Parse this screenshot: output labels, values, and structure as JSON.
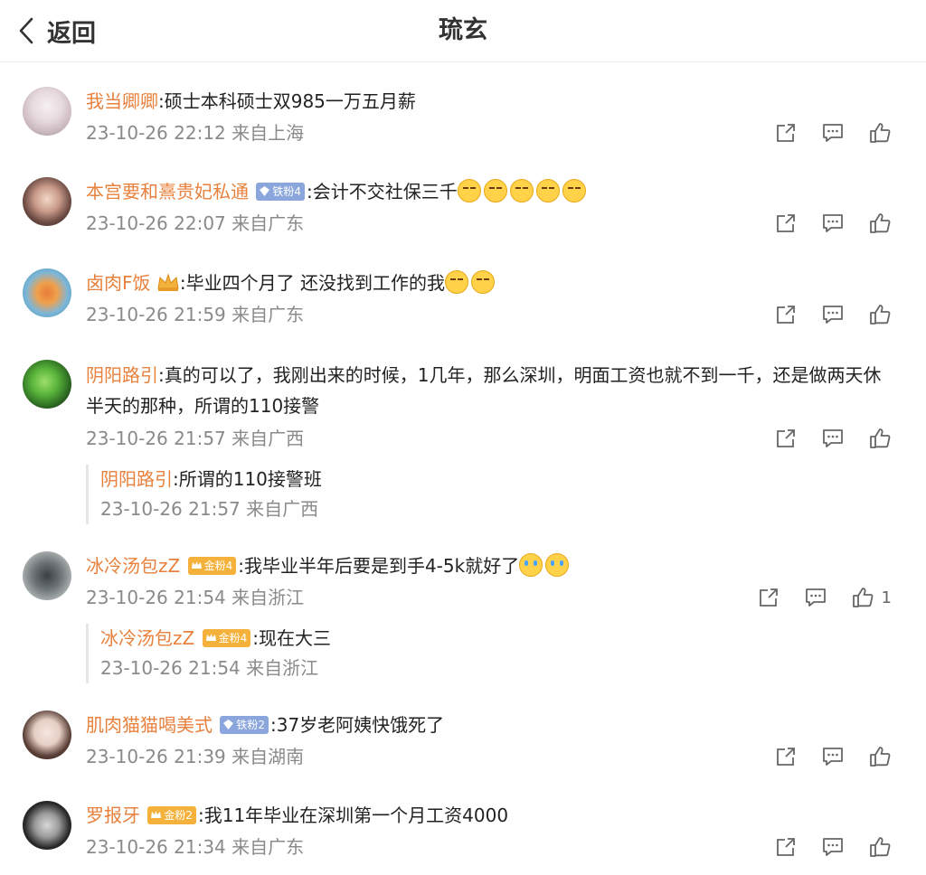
{
  "header": {
    "back_label": "返回",
    "title": "琉玄"
  },
  "comments": [
    {
      "username": "我当卿卿",
      "text": ":硕士本科硕士双985一万五月薪",
      "meta": "23-10-26 22:12 来自上海"
    },
    {
      "username": "本宫要和熹贵妃私通",
      "badge": "铁粉4",
      "text": ":会计不交社保三千",
      "meta": "23-10-26 22:07 来自广东"
    },
    {
      "username": "卤肉F饭",
      "text": ":毕业四个月了 还没找到工作的我",
      "meta": "23-10-26 21:59 来自广东"
    },
    {
      "username": "阴阳路引",
      "text": ":真的可以了，我刚出来的时候，1几年，那么深圳，明面工资也就不到一千，还是做两天休半天的那种，所谓的110接警",
      "meta": "23-10-26 21:57 来自广西",
      "reply": {
        "username": "阴阳路引",
        "text": ":所谓的110接警班",
        "meta": "23-10-26 21:57 来自广西"
      }
    },
    {
      "username": "冰冷汤包zZ",
      "badge": "金粉4",
      "text": ":我毕业半年后要是到手4-5k就好了",
      "meta": "23-10-26 21:54 来自浙江",
      "likes": "1",
      "reply": {
        "username": "冰冷汤包zZ",
        "badge": "金粉4",
        "text": ":现在大三",
        "meta": "23-10-26 21:54 来自浙江"
      }
    },
    {
      "username": "肌肉猫猫喝美式",
      "badge": "铁粉2",
      "text": ":37岁老阿姨快饿死了",
      "meta": "23-10-26 21:39 来自湖南"
    },
    {
      "username": "罗报牙",
      "badge": "金粉2",
      "text": ":我11年毕业在深圳第一个月工资4000",
      "meta": "23-10-26 21:34 来自广东"
    }
  ],
  "colors": {
    "username": "#e8813d",
    "meta": "#8a8a8a",
    "iron_badge": "#8aa6dc",
    "gold_badge": "#f4b23c"
  }
}
